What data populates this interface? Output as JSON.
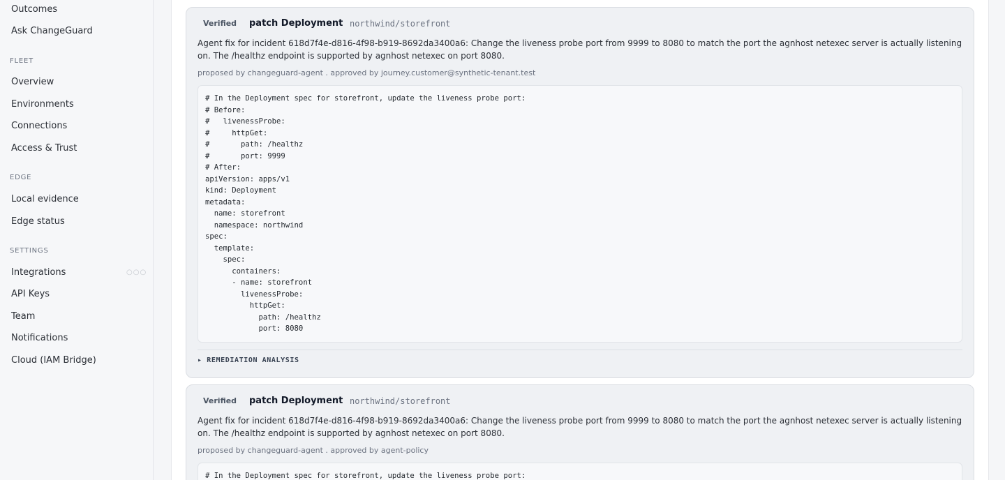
{
  "sidebar": {
    "top_items": [
      {
        "label": "Outcomes"
      },
      {
        "label": "Ask ChangeGuard"
      }
    ],
    "sections": [
      {
        "title": "FLEET",
        "items": [
          {
            "label": "Overview"
          },
          {
            "label": "Environments"
          },
          {
            "label": "Connections"
          },
          {
            "label": "Access & Trust"
          }
        ]
      },
      {
        "title": "EDGE",
        "items": [
          {
            "label": "Local evidence"
          },
          {
            "label": "Edge status"
          }
        ]
      },
      {
        "title": "SETTINGS",
        "items": [
          {
            "label": "Integrations"
          },
          {
            "label": "API Keys"
          },
          {
            "label": "Team"
          },
          {
            "label": "Notifications"
          },
          {
            "label": "Cloud (IAM Bridge)"
          }
        ]
      }
    ],
    "dots": "○○○"
  },
  "cards": [
    {
      "badge": "Verified",
      "action": "patch Deployment",
      "target": "northwind/storefront",
      "description": "Agent fix for incident 618d7f4e-d816-4f98-b919-8692da3400a6: Change the liveness probe port from 9999 to 8080 to match the port the agnhost netexec server is actually listening on. The /healthz endpoint is supported by agnhost netexec on port 8080.",
      "meta": "proposed by changeguard-agent . approved by journey.customer@synthetic-tenant.test",
      "code": "# In the Deployment spec for storefront, update the liveness probe port:\n# Before:\n#   livenessProbe:\n#     httpGet:\n#       path: /healthz\n#       port: 9999\n# After:\napiVersion: apps/v1\nkind: Deployment\nmetadata:\n  name: storefront\n  namespace: northwind\nspec:\n  template:\n    spec:\n      containers:\n      - name: storefront\n        livenessProbe:\n          httpGet:\n            path: /healthz\n            port: 8080",
      "analysis_toggle": "▸ REMEDIATION ANALYSIS"
    },
    {
      "badge": "Verified",
      "action": "patch Deployment",
      "target": "northwind/storefront",
      "description": "Agent fix for incident 618d7f4e-d816-4f98-b919-8692da3400a6: Change the liveness probe port from 9999 to 8080 to match the port the agnhost netexec server is actually listening on. The /healthz endpoint is supported by agnhost netexec on port 8080.",
      "meta": "proposed by changeguard-agent . approved by agent-policy",
      "code": "# In the Deployment spec for storefront, update the liveness probe port:"
    }
  ]
}
